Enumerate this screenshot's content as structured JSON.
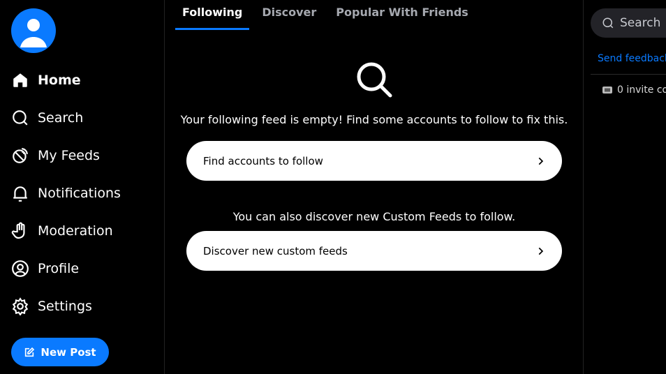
{
  "sidebar": {
    "items": [
      {
        "label": "Home",
        "icon": "home-icon"
      },
      {
        "label": "Search",
        "icon": "search-icon"
      },
      {
        "label": "My Feeds",
        "icon": "feeds-icon"
      },
      {
        "label": "Notifications",
        "icon": "bell-icon"
      },
      {
        "label": "Moderation",
        "icon": "hand-icon"
      },
      {
        "label": "Profile",
        "icon": "profile-icon"
      },
      {
        "label": "Settings",
        "icon": "gear-icon"
      }
    ],
    "new_post": "New Post"
  },
  "tabs": [
    {
      "label": "Following"
    },
    {
      "label": "Discover"
    },
    {
      "label": "Popular With Friends"
    }
  ],
  "main": {
    "empty_message": "Your following feed is empty! Find some accounts to follow to fix this.",
    "find_button": "Find accounts to follow",
    "discover_message": "You can also discover new Custom Feeds to follow.",
    "discover_button": "Discover new custom feeds"
  },
  "right": {
    "search_placeholder": "Search",
    "feedback": "Send feedback",
    "invite": "0 invite co"
  },
  "colors": {
    "accent": "#0a7aff",
    "background": "#000000"
  }
}
